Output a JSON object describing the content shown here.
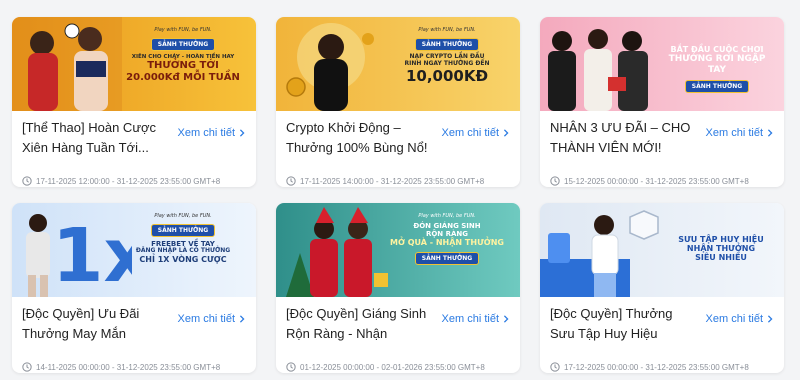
{
  "cards": [
    {
      "title": "[Thể Thao] Hoàn Cược Xiên Hàng Tuần Tới...",
      "more": "Xem chi tiết",
      "date": "17-11-2025 12:00:00 - 31-12-2025 23:55:00 GMT+8",
      "banner": {
        "tagline": "Play with FUN, be FUN.",
        "badge": "SẢNH THƯỞNG",
        "lines": [
          "XIÊN CHO CHÁY - HOÀN TIỀN HAY",
          "THƯỞNG TỚI",
          "20.000Kđ MỖI TUẦN"
        ],
        "bg": "#f4b21c"
      }
    },
    {
      "title": "Crypto Khởi Động – Thưởng 100% Bùng Nổ!",
      "more": "Xem chi tiết",
      "date": "17-11-2025 14:00:00 - 31-12-2025 23:55:00 GMT+8",
      "banner": {
        "tagline": "Play with FUN, be FUN.",
        "badge": "SẢNH THƯỞNG",
        "lines": [
          "NẠP CRYPTO LẦN ĐẦU",
          "RINH NGAY THƯỞNG ĐẾN",
          "10,000KĐ"
        ],
        "bg": "#f6c64a"
      }
    },
    {
      "title": "NHÂN 3 ƯU ĐÃI – CHO THÀNH VIÊN MỚI!",
      "more": "Xem chi tiết",
      "date": "15-12-2025 00:00:00 - 31-12-2025 23:55:00 GMT+8",
      "banner": {
        "tagline": "",
        "badge": "SẢNH THƯỞNG",
        "lines": [
          "BẮT ĐẦU CUỘC CHƠI",
          "THƯỞNG RƠI NGẬP TAY"
        ],
        "bg": "#f7c1cf"
      }
    },
    {
      "title": "[Độc Quyền] Ưu Đãi Thưởng May Mắn",
      "more": "Xem chi tiết",
      "date": "14-11-2025 00:00:00 - 31-12-2025 23:55:00 GMT+8",
      "banner": {
        "tagline": "Play with FUN, be FUN.",
        "badge": "SẢNH THƯỞNG",
        "lines": [
          "FREEBET VỀ TAY",
          "ĐĂNG NHẬP LÀ CÓ THƯỞNG",
          "CHỈ 1X VÒNG CƯỢC"
        ],
        "bg": "#dbe9fb"
      }
    },
    {
      "title": "[Độc Quyền] Giáng Sinh Rộn Ràng - Nhận Thưởn...",
      "more": "Xem chi tiết",
      "date": "01-12-2025 00:00:00 - 02-01-2026 23:55:00 GMT+8",
      "banner": {
        "tagline": "Play with FUN, be FUN.",
        "badge": "SẢNH THƯỞNG",
        "lines": [
          "ĐÓN GIÁNG SINH",
          "RỘN RÀNG",
          "MỞ QUÀ - NHẬN THƯỞNG"
        ],
        "bg": "#4fb7b0"
      }
    },
    {
      "title": "[Độc Quyền] Thưởng Sưu Tập Huy Hiệu",
      "more": "Xem chi tiết",
      "date": "17-12-2025 00:00:00 - 31-12-2025 23:55:00 GMT+8",
      "banner": {
        "tagline": "",
        "badge": "",
        "lines": [
          "SƯU TẬP HUY HIỆU",
          "NHẬN THƯỞNG",
          "SIÊU NHIỀU"
        ],
        "bg": "#e6eef8"
      }
    }
  ]
}
